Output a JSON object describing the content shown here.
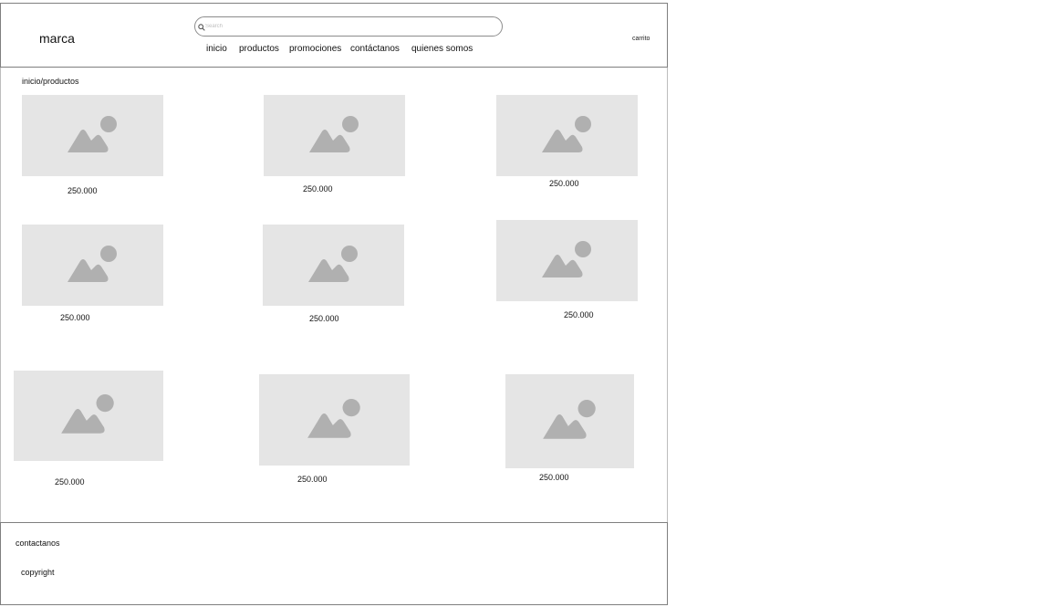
{
  "header": {
    "brand": "marca",
    "search_placeholder": "Search",
    "nav": [
      "inicio",
      "productos",
      "promociones",
      "contáctanos",
      "quienes somos"
    ],
    "cart": "carrito"
  },
  "breadcrumb": "inicio/productos",
  "products": [
    {
      "price": "250.000"
    },
    {
      "price": "250.000"
    },
    {
      "price": "250.000"
    },
    {
      "price": "250.000"
    },
    {
      "price": "250.000"
    },
    {
      "price": "250.000"
    },
    {
      "price": "250.000"
    },
    {
      "price": "250.000"
    },
    {
      "price": "250.000"
    }
  ],
  "footer": {
    "contact": "contactanos",
    "copyright": "copyright"
  },
  "colors": {
    "placeholder_bg": "#e5e5e5",
    "placeholder_icon": "#b0b0b0"
  }
}
